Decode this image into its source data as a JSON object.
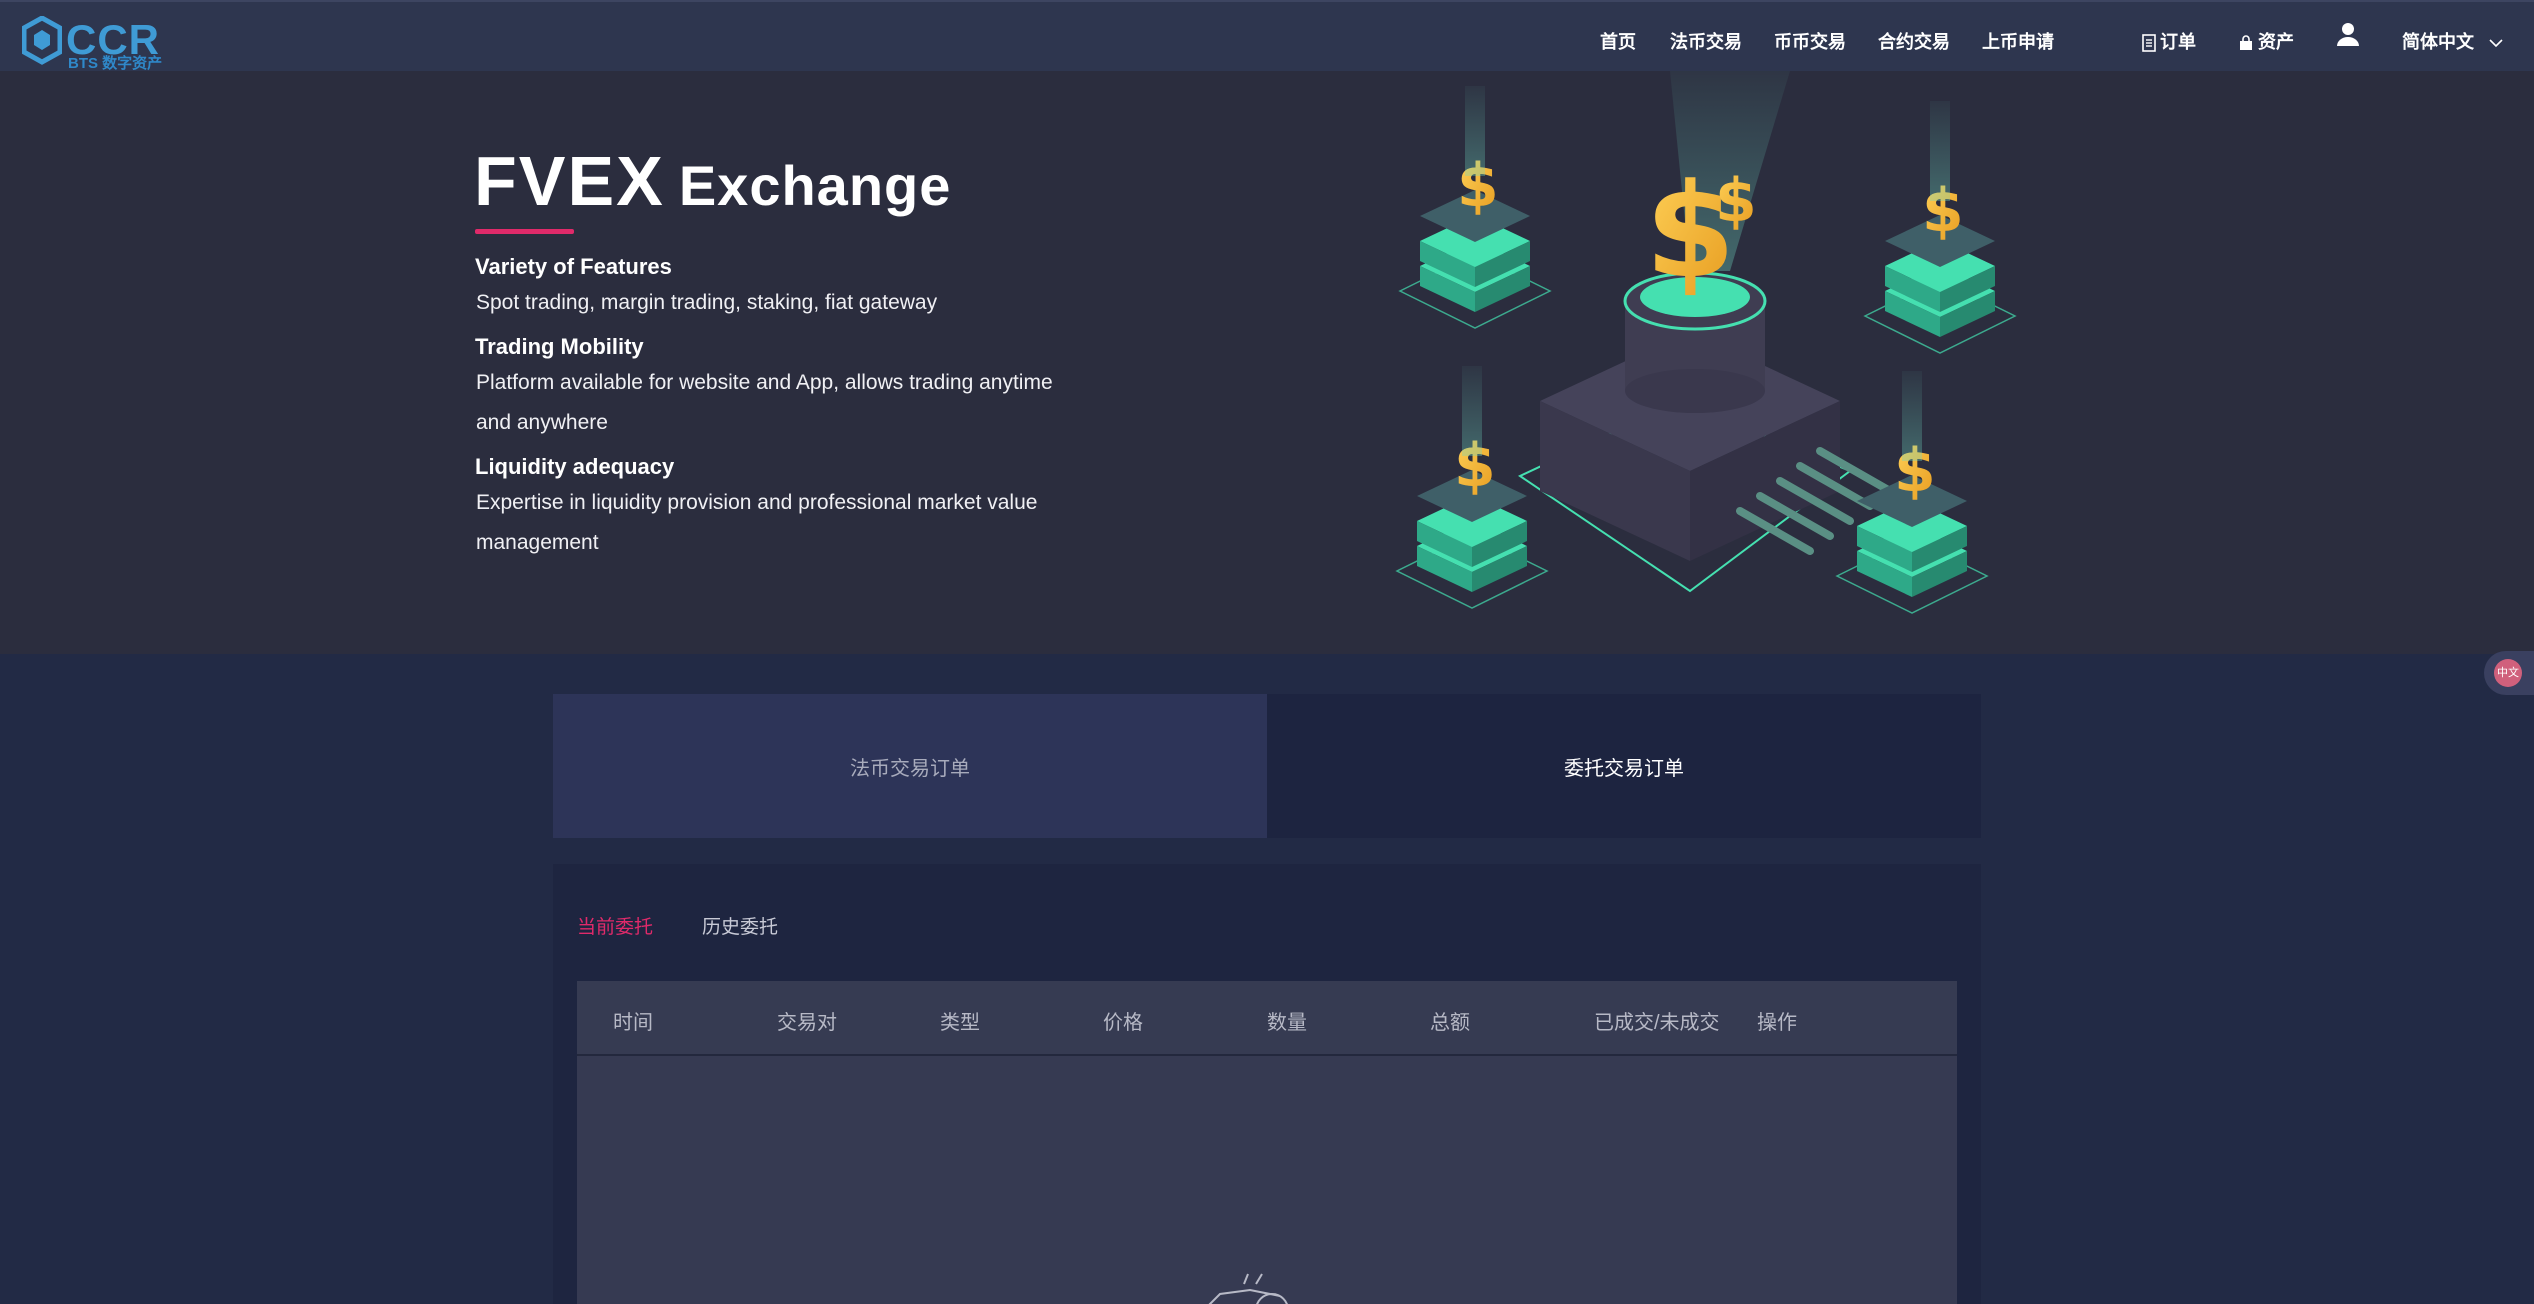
{
  "brand": {
    "logo_text": "CCR",
    "logo_sub": "BTS 数字资产",
    "logo_color": "#3f9bd5"
  },
  "nav": {
    "items": [
      {
        "label": "首页"
      },
      {
        "label": "法币交易"
      },
      {
        "label": "币币交易"
      },
      {
        "label": "合约交易"
      },
      {
        "label": "上币申请"
      }
    ],
    "orders_label": "订单",
    "assets_label": "资产",
    "language": "简体中文"
  },
  "hero": {
    "title_big": "FVEX",
    "title_small": "Exchange",
    "accent_color": "#e02a6a",
    "features": [
      {
        "title": "Variety of Features",
        "desc": "Spot trading, margin trading, staking, fiat gateway"
      },
      {
        "title": "Trading Mobility",
        "desc": "Platform available for website and App, allows trading anytime and anywhere"
      },
      {
        "title": "Liquidity adequacy",
        "desc": "Expertise in liquidity provision and professional market value management"
      }
    ]
  },
  "orders": {
    "tabs": [
      {
        "label": "法币交易订单",
        "active": false
      },
      {
        "label": "委托交易订单",
        "active": true
      }
    ],
    "subtabs": [
      {
        "label": "当前委托",
        "active": true
      },
      {
        "label": "历史委托",
        "active": false
      }
    ],
    "columns": [
      "时间",
      "交易对",
      "类型",
      "价格",
      "数量",
      "总额",
      "已成交/未成交",
      "操作"
    ],
    "rows": []
  },
  "side_badge": {
    "label": "中文"
  }
}
